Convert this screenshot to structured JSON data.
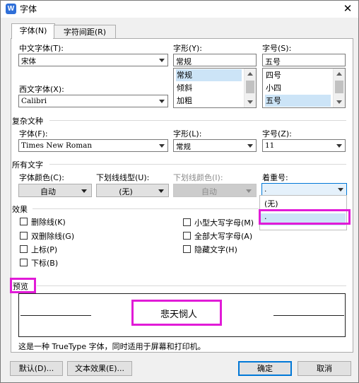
{
  "window": {
    "title": "字体",
    "app_icon_letter": "W",
    "close_glyph": "✕"
  },
  "tabs": [
    {
      "label": "字体(N)",
      "active": true
    },
    {
      "label": "字符间距(R)",
      "active": false
    }
  ],
  "fields": {
    "chinese_font": {
      "label": "中文字体(T):",
      "value": "宋体"
    },
    "font_style": {
      "label": "字形(Y):",
      "value": "常规",
      "options": [
        "常规",
        "倾斜",
        "加粗"
      ],
      "selected": "常规"
    },
    "font_size": {
      "label": "字号(S):",
      "value": "五号",
      "options": [
        "四号",
        "小四",
        "五号"
      ],
      "selected": "五号"
    },
    "western_font": {
      "label": "西文字体(X):",
      "value": "Calibri"
    }
  },
  "complex": {
    "section_label": "复杂文种",
    "font": {
      "label": "字体(F):",
      "value": "Times New Roman"
    },
    "style": {
      "label": "字形(L):",
      "value": "常规"
    },
    "size": {
      "label": "字号(Z):",
      "value": "11"
    }
  },
  "all_text": {
    "section_label": "所有文字",
    "font_color": {
      "label": "字体颜色(C):",
      "value": "自动"
    },
    "underline_type": {
      "label": "下划线线型(U):",
      "value": "(无)"
    },
    "underline_color": {
      "label": "下划线颜色(I):",
      "value": "自动"
    },
    "emphasis": {
      "label": "着重号:",
      "value": ".",
      "options": [
        "(无)",
        "."
      ]
    }
  },
  "effects": {
    "section_label": "效果",
    "left": [
      "删除线(K)",
      "双删除线(G)",
      "上标(P)",
      "下标(B)"
    ],
    "right": [
      "小型大写字母(M)",
      "全部大写字母(A)",
      "隐藏文字(H)"
    ]
  },
  "preview": {
    "section_label": "预览",
    "sample": "悲天悯人",
    "note": "这是一种 TrueType 字体，同时适用于屏幕和打印机。"
  },
  "buttons": {
    "default": "默认(D)...",
    "text_effects": "文本效果(E)...",
    "ok": "确定",
    "cancel": "取消"
  },
  "colors": {
    "highlight": "#e11bd7",
    "selection": "#cce4f7",
    "focus_border": "#0078d7"
  }
}
